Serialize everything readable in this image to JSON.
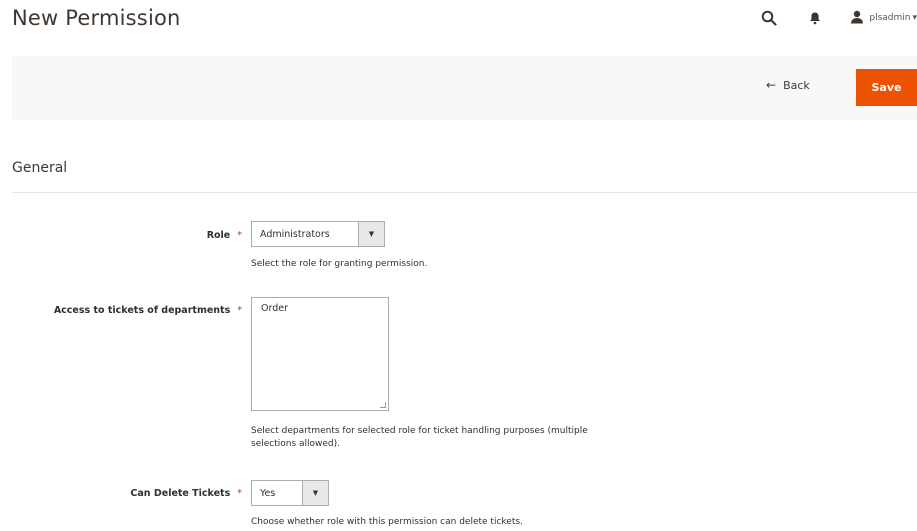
{
  "header": {
    "title": "New Permission",
    "user_name": "plsadmin",
    "search_icon": "search-icon",
    "bell_icon": "bell-icon",
    "user_icon": "user-icon"
  },
  "actions": {
    "back_label": "Back",
    "save_label": "Save",
    "save_color": "#eb5202"
  },
  "section": {
    "title": "General"
  },
  "form": {
    "role": {
      "label": "Role",
      "value": "Administrators",
      "note": "Select the role for granting permission."
    },
    "departments": {
      "label": "Access to tickets of departments",
      "options": [
        "Order"
      ],
      "note_line1": "Select departments for selected role for ticket handling purposes (multiple",
      "note_line2": "selections allowed)."
    },
    "can_delete": {
      "label": "Can Delete Tickets",
      "value": "Yes",
      "note": "Choose whether role with this permission can delete tickets."
    },
    "required_mark": "*"
  }
}
